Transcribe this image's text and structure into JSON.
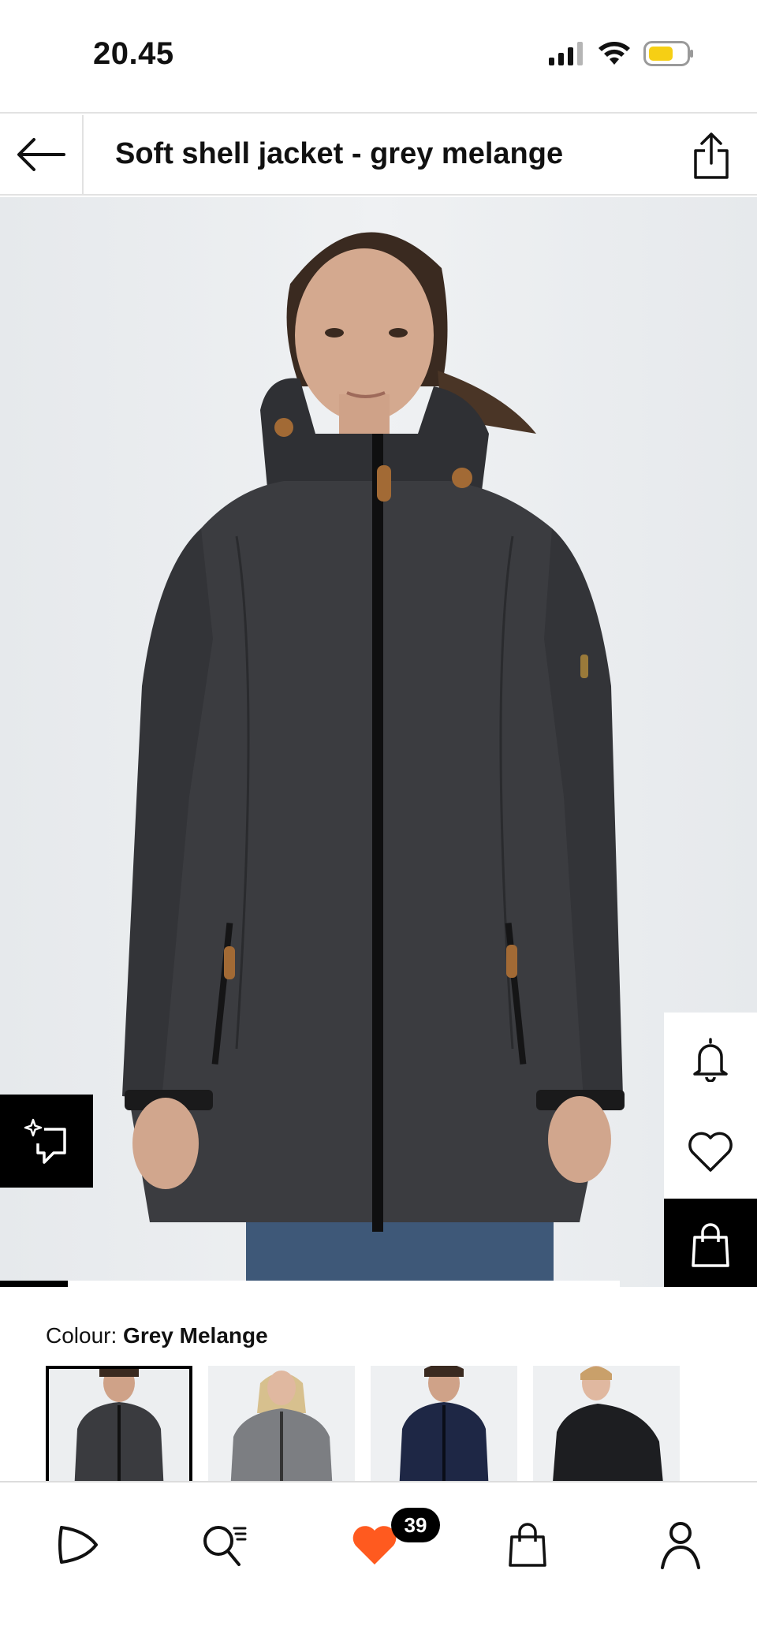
{
  "status_bar": {
    "time": "20.45",
    "battery_color": "#f6cf14"
  },
  "header": {
    "title": "Soft shell jacket - grey melange",
    "back_icon": "arrow-left-icon",
    "share_icon": "share-icon"
  },
  "product": {
    "image_alt": "Woman wearing dark grey soft shell jacket",
    "ar_icon": "ar-view-icon"
  },
  "side_actions": [
    {
      "name": "notify-button",
      "icon": "bell-icon"
    },
    {
      "name": "wishlist-button",
      "icon": "heart-icon"
    },
    {
      "name": "add-to-bag-button",
      "icon": "bag-icon"
    }
  ],
  "colour": {
    "label": "Colour:",
    "selected": "Grey Melange",
    "swatches": [
      {
        "jacket_color": "#3a3b3f",
        "selected": true
      },
      {
        "jacket_color": "#7c7e82",
        "selected": false
      },
      {
        "jacket_color": "#1e2745",
        "selected": false
      },
      {
        "jacket_color": "#1d1e21",
        "selected": false
      }
    ]
  },
  "bottom_nav": {
    "items": [
      {
        "name": "nav-home",
        "icon": "play-logo-icon"
      },
      {
        "name": "nav-search",
        "icon": "search-list-icon"
      },
      {
        "name": "nav-wishlist",
        "icon": "heart-icon"
      },
      {
        "name": "nav-bag",
        "icon": "bag-icon"
      },
      {
        "name": "nav-account",
        "icon": "user-icon"
      }
    ],
    "wishlist_count": "39",
    "accent_color": "#ff5a1f"
  }
}
